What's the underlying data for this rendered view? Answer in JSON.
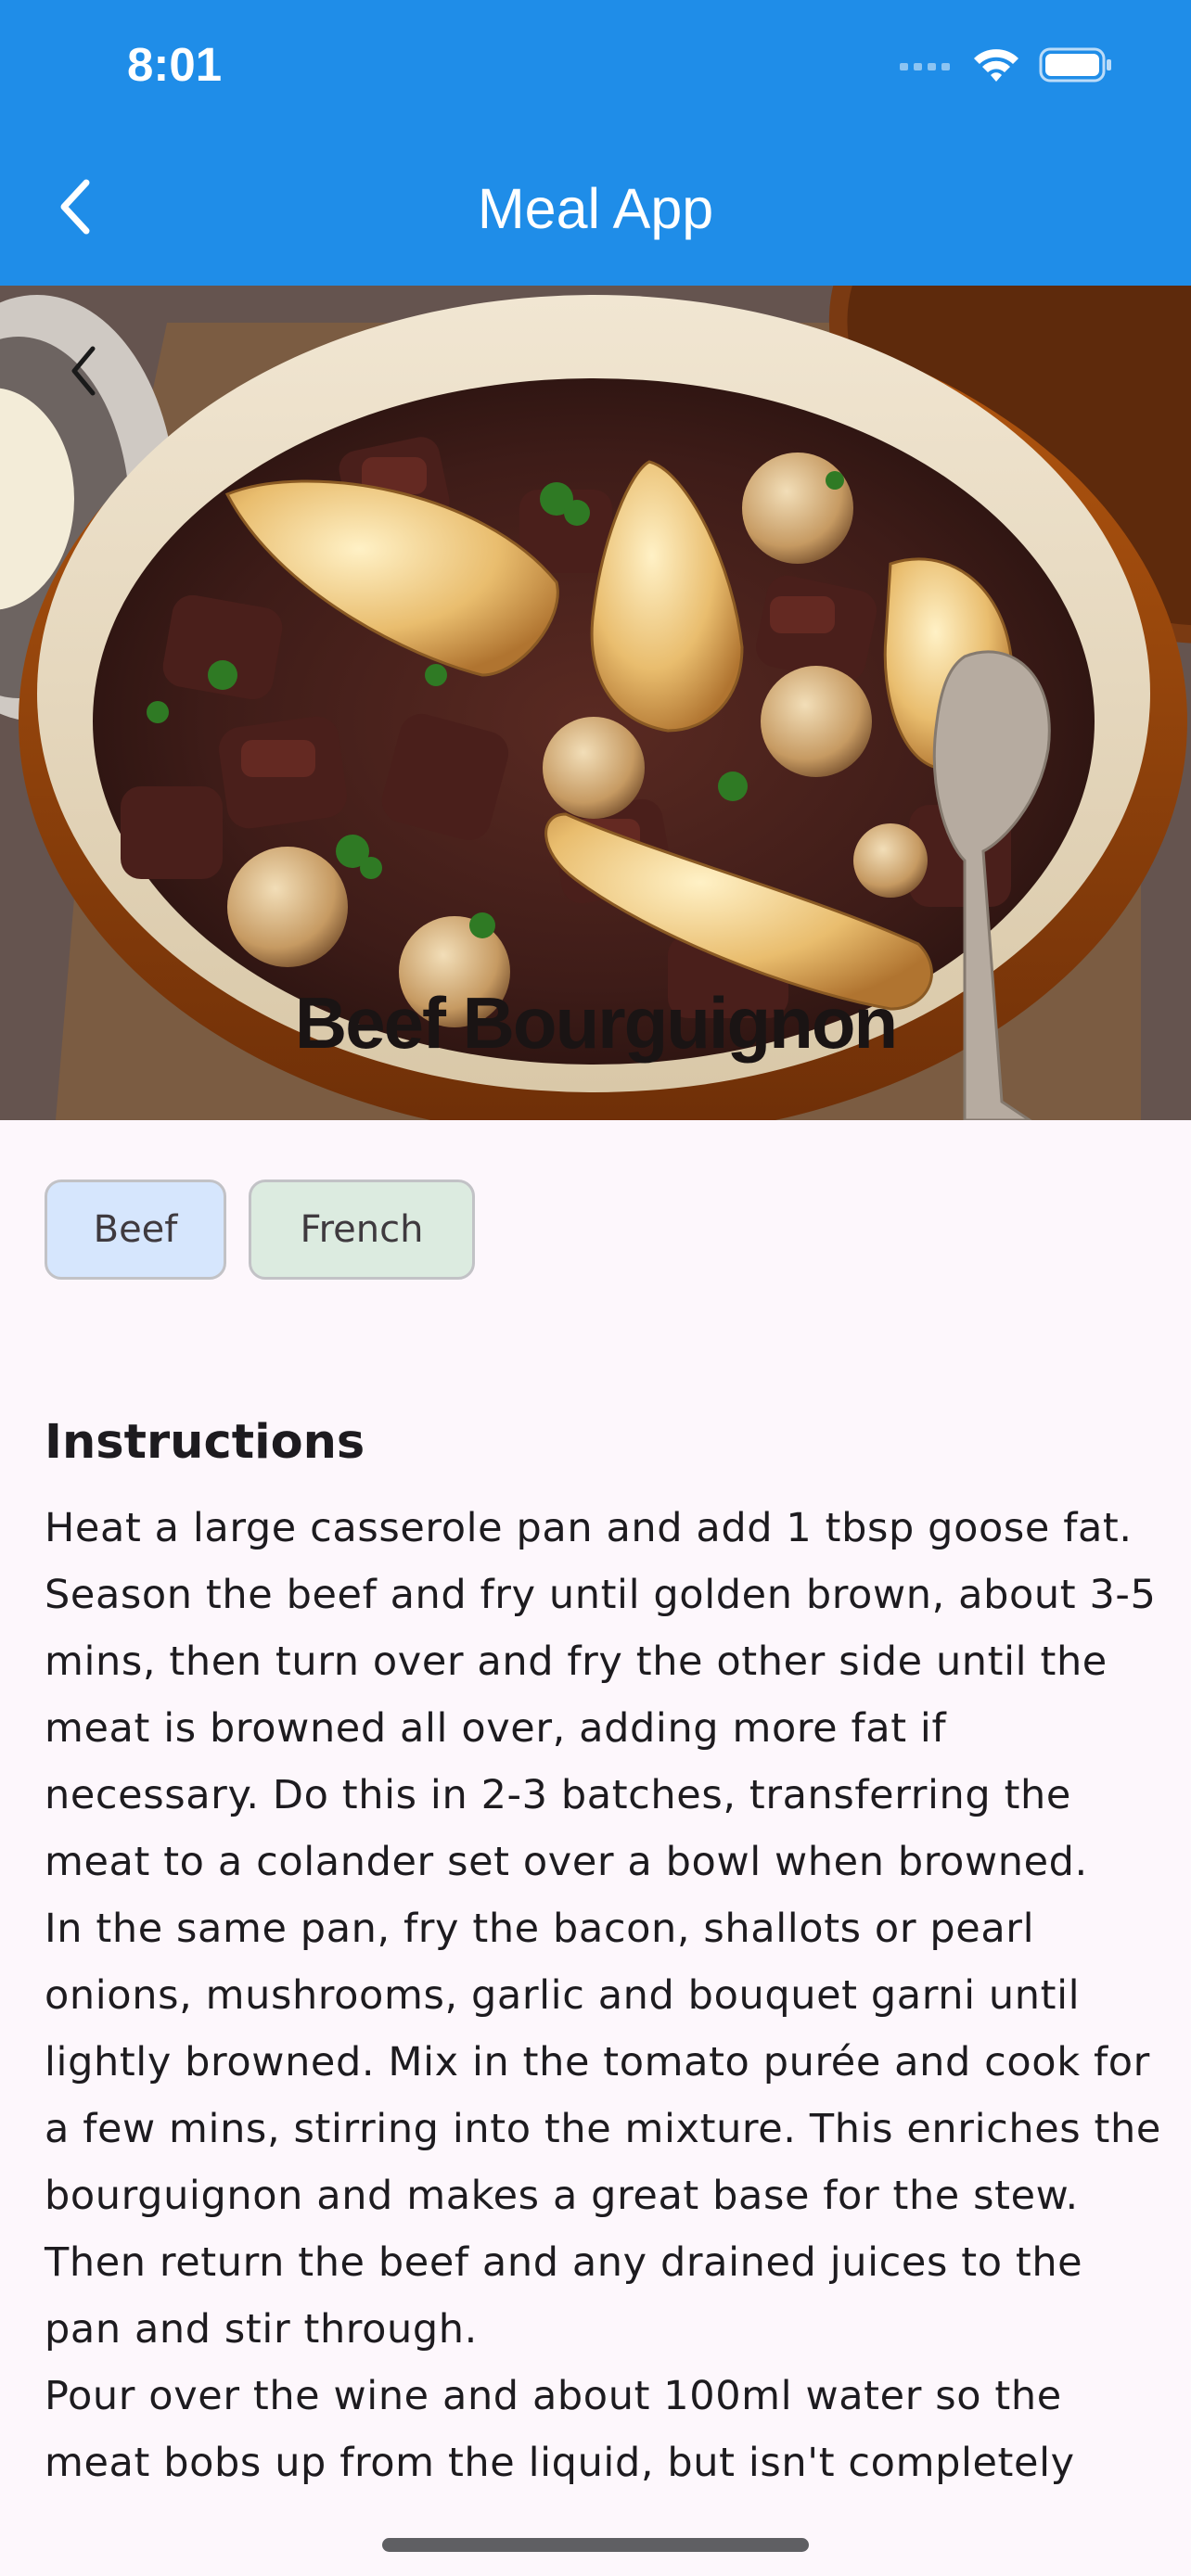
{
  "status_bar": {
    "time": "8:01",
    "icons": [
      "cellular-signal-icon",
      "wifi-icon",
      "battery-icon"
    ]
  },
  "app_bar": {
    "title": "Meal App",
    "back_icon": "chevron-left-icon"
  },
  "meal": {
    "title": "Beef Bourguignon",
    "image_back_icon": "chevron-left-icon",
    "tags": [
      {
        "label": "Beef",
        "color": "#d6e6fd"
      },
      {
        "label": "French",
        "color": "#dcebe0"
      }
    ]
  },
  "instructions": {
    "heading": "Instructions",
    "text": "Heat a large casserole pan and add 1 tbsp goose fat. Season the beef and fry until golden brown, about 3-5 mins, then turn over and fry the other side until the meat is browned all over, adding more fat if necessary. Do this in 2-3 batches, transferring the meat to a colander set over a bowl when browned.\nIn the same pan, fry the bacon, shallots or pearl onions, mushrooms, garlic and bouquet garni until lightly browned. Mix in the tomato purée and cook for a few mins, stirring into the mixture. This enriches the bourguignon and makes a great base for the stew. Then return the beef and any drained juices to the pan and stir through.\nPour over the wine and about 100ml water so the meat bobs up from the liquid, but isn't completely"
  },
  "colors": {
    "app_bar": "#1f8de8",
    "background": "#fdf7fc",
    "chip_beef": "#d6e6fd",
    "chip_french": "#dcebe0"
  }
}
